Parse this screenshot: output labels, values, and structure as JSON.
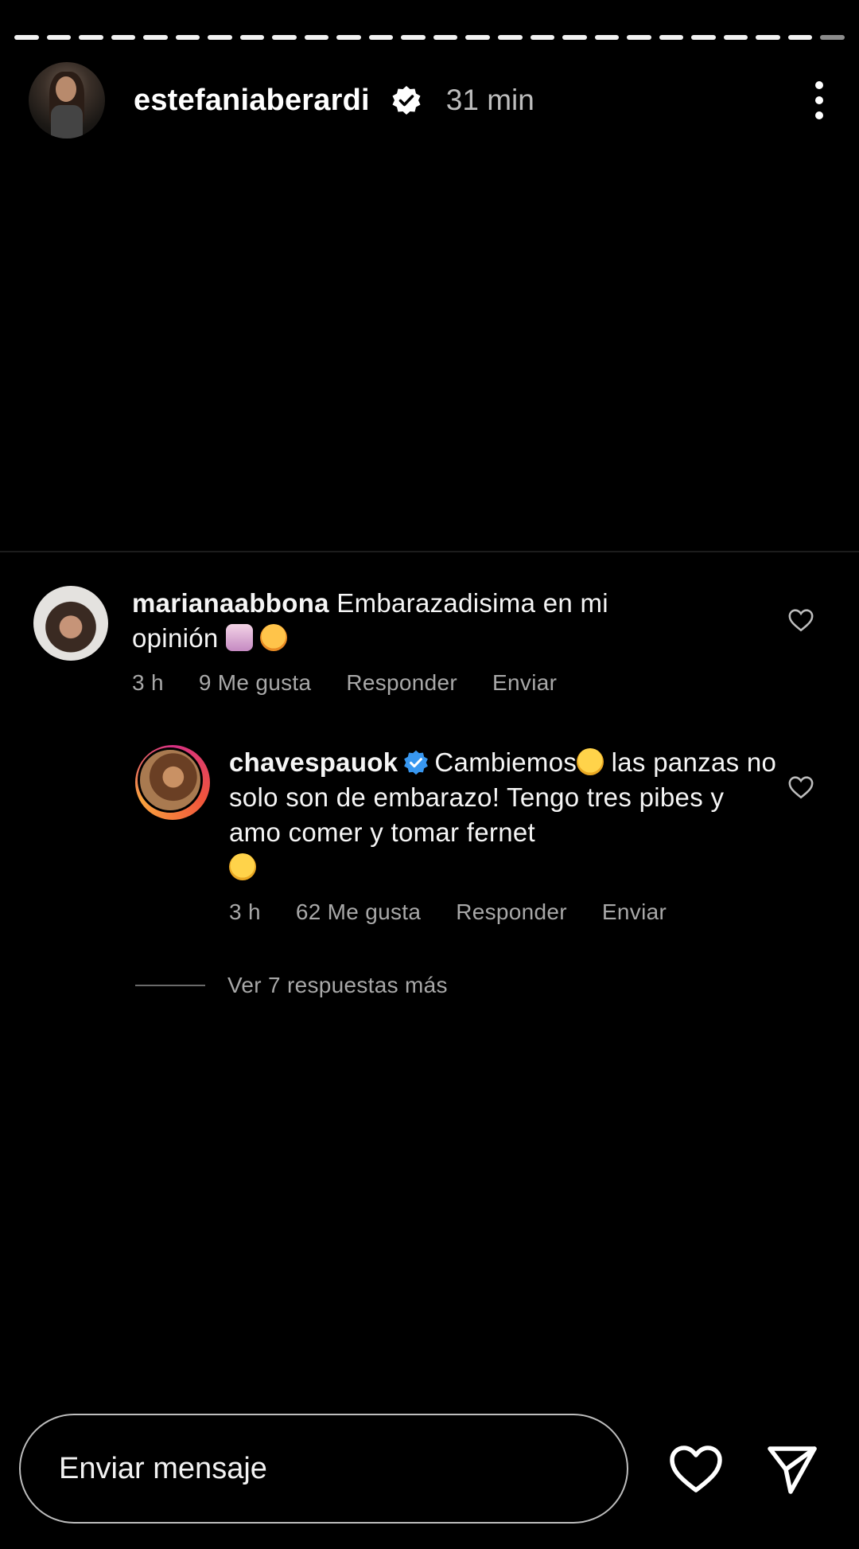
{
  "story": {
    "segments": 26,
    "header": {
      "username": "estefaniaberardi",
      "verified": true,
      "time": "31 min"
    }
  },
  "comments": {
    "first": {
      "username": "marianaabbona",
      "text": "Embarazadisima en mi opinión",
      "time": "3 h",
      "likes": "9 Me gusta",
      "reply": "Responder",
      "send": "Enviar"
    },
    "reply": {
      "username": "chavespauok",
      "verified": true,
      "text_part1": "Cambiemos",
      "text_part2": "las panzas no solo son de embarazo! Tengo tres pibes y amo comer y tomar fernet",
      "time": "3 h",
      "likes": "62 Me gusta",
      "reply": "Responder",
      "send": "Enviar"
    },
    "more_replies": "Ver 7 respuestas más"
  },
  "footer": {
    "message_placeholder": "Enviar mensaje"
  },
  "colors": {
    "background": "#000000",
    "text_primary": "#ffffff",
    "text_secondary": "#a8a8a8",
    "verified_blue": "#3897f0"
  }
}
